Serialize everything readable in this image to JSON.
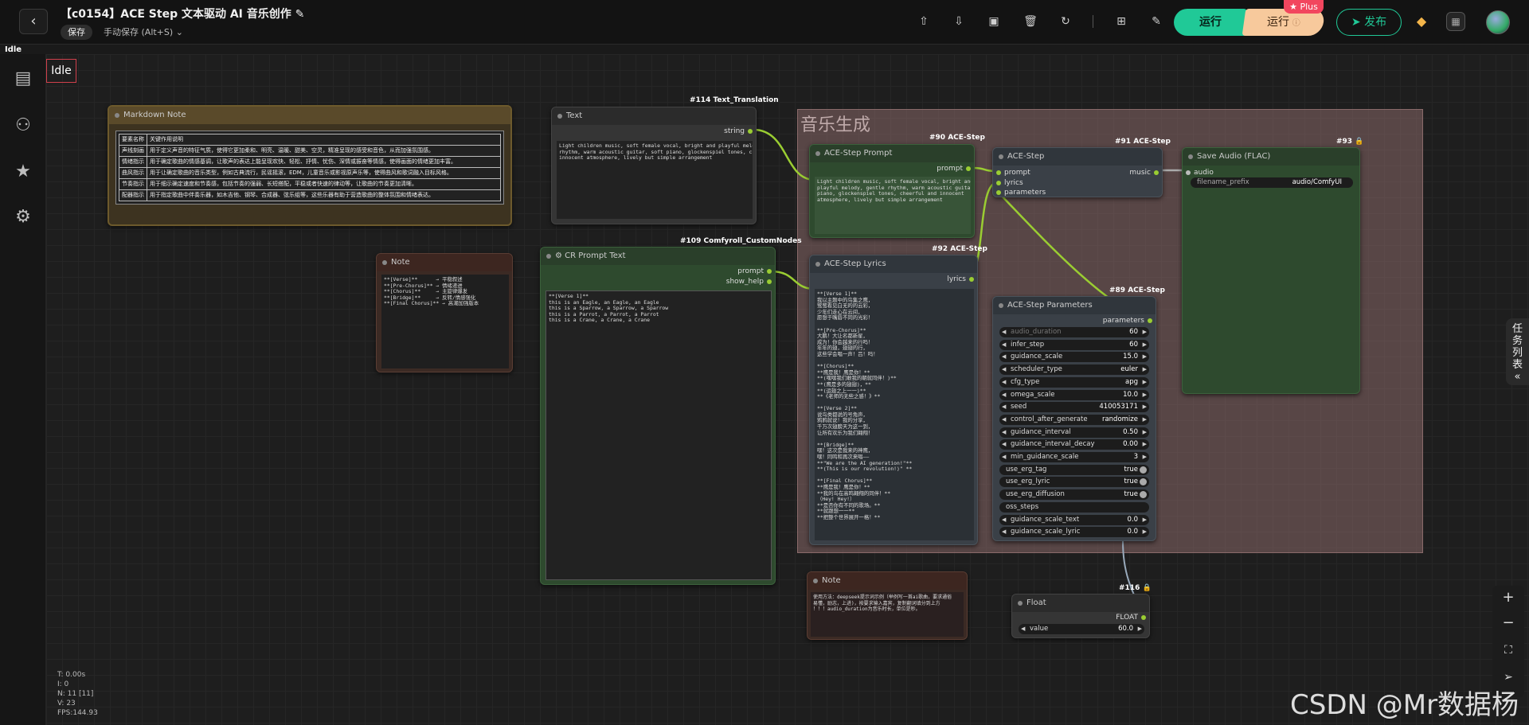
{
  "header": {
    "title": "【c0154】ACE Step 文本驱动 AI 音乐创作",
    "save": "保存",
    "autosave": "手动保存 (Alt+S)",
    "run": "运行",
    "run_plus": "运行",
    "plus_badge": "Plus",
    "publish": "发布"
  },
  "status": {
    "idle_small": "Idle",
    "idle": "Idle",
    "stats": [
      "T: 0.00s",
      "I: 0",
      "N: 11 [11]",
      "V: 23",
      "FPS:144.93"
    ]
  },
  "nodes": {
    "markdown": {
      "title": "Markdown Note",
      "rows": [
        [
          "要素名称",
          "关键作用说明"
        ],
        [
          "声线刻画",
          "用于定义声音的特征气质，使得它更加柔和、明亮、温暖、甜美、空灵，精准呈现的感受和音色，从而加强氛围感。"
        ],
        [
          "情绪指示",
          "用于确定歌曲的情感基调，让歌声的表达上能呈现欢快、轻松、抒情、忧伤、深情或振奋等情感，使得画面的情绪更加丰富。"
        ],
        [
          "曲风指示",
          "用于让确定歌曲的音乐类型，例如古典流行，民谣摇滚，EDM，儿童音乐或影视原声乐等，使得曲风和歌词融入目标风格。"
        ],
        [
          "节奏指示",
          "用于细示确定速度和节奏感，包括节奏的强弱、长短搭配，平稳或者快速的律动等，让歌曲的节奏更加清晰。"
        ],
        [
          "配器指示",
          "用于指定歌曲中伴奏乐器，如木吉他、钢琴、合成器、弦乐组等，这些乐器有助于营造歌曲的整体氛围和情绪表达。"
        ]
      ]
    },
    "text": {
      "tag": "#114 Text_Translation",
      "title": "Text",
      "out": "string",
      "content": "Light children music, soft female vocal, bright and playful melody, gentle\nrhythm, warm acoustic guitar, soft piano, glockenspiel tones, cheerful and\ninnocent atmosphere, lively but simple arrangement"
    },
    "note1": {
      "title": "Note",
      "content": "**[Verse]**      → 平稳叙述\n**[Pre-Chorus]** → 情绪递进\n**[Chorus]**     → 主旋律爆发\n**[Bridge]**     → 反转/情感强化\n**[Final Chorus]** → 高潮加强版本"
    },
    "cr": {
      "tag": "#109 Comfyroll_CustomNodes",
      "title": "CR Prompt Text",
      "out1": "prompt",
      "out2": "show_help",
      "content": "**[Verse 1]**\nthis is an Eagle, an Eagle, an Eagle\nthis is a Sparrow, a Sparrow, a Sparrow\nthis is a Parrot, a Parrot, a Parrot\nthis is a Crane, a Crane, a Crane"
    },
    "group": {
      "title": "音乐生成"
    },
    "ace_prompt": {
      "tag": "#90 ACE-Step",
      "title": "ACE-Step Prompt",
      "out": "prompt",
      "content": "Light children music, soft female vocal, bright and\nplayful melody, gentle rhythm, warm acoustic guitar, soft\npiano, glockenspiel tones, cheerful and innocent\natmosphere, lively but simple arrangement"
    },
    "ace_lyrics": {
      "tag": "#92 ACE-Step",
      "title": "ACE-Step Lyrics",
      "out": "lyrics",
      "content": "**[Verse 1]**\n我以主题中的鸟集之鹰，\n鹭鹭看见白无的的云彩，\n少年们走心在云间，\n愿想于嘴唇不同的光彩！\n\n**[Pre-Chorus]**\n大鹏！大让名都新星，\n成为！你会越来的行吗！\n年年的翅，翅翅的行，\n这些学会唱一声！吕！吗！\n\n**[Chorus]**\n**鹰是我！鹰是你！**\n**(嘿嘿我们敢我的朝就同伴！)**\n**(鹰是多的翅翅)，**\n**(运翅之上一一)**\n**《老师的无些之感！》**\n\n**[Verse 2]**\n说鸟类都说的号角声，\n鸦鸦就说！我的分享，\n千万次翅膀天为这一到，\n让所有欢乐为我们翱翔！\n\n**[Bridge]**\n嘿！这次是我来的神鹰，\n嘿！同鸣和再次来唱——\n**\"We are the AI generation!\"**\n**(This is our revolution!)\" **\n\n**[Final Chorus]**\n**鹰是我！鹰是你！**\n**我的鸟在高鸣翱翔的同伴！**\n（Hey! Hey!）\n**是否你有不同的歌场。**\n**就跟想一一**\n**把整个世界展开一格！**"
    },
    "ace_step": {
      "tag": "#91 ACE-Step",
      "title": "ACE-Step",
      "in1": "prompt",
      "in2": "lyrics",
      "in3": "parameters",
      "out": "music"
    },
    "save_audio": {
      "tag": "#93 🔒",
      "title": "Save Audio (FLAC)",
      "in": "audio",
      "w_label": "filename_prefix",
      "w_value": "audio/ComfyUI"
    },
    "params": {
      "tag": "#89 ACE-Step",
      "title": "ACE-Step Parameters",
      "out": "parameters",
      "widgets": [
        [
          "audio_duration",
          "60"
        ],
        [
          "infer_step",
          "60"
        ],
        [
          "guidance_scale",
          "15.0"
        ],
        [
          "scheduler_type",
          "euler"
        ],
        [
          "cfg_type",
          "apg"
        ],
        [
          "omega_scale",
          "10.0"
        ],
        [
          "seed",
          "410053171"
        ],
        [
          "control_after_generate",
          "randomize"
        ],
        [
          "guidance_interval",
          "0.50"
        ],
        [
          "guidance_interval_decay",
          "0.00"
        ],
        [
          "min_guidance_scale",
          "3"
        ],
        [
          "use_erg_tag",
          "true"
        ],
        [
          "use_erg_lyric",
          "true"
        ],
        [
          "use_erg_diffusion",
          "true"
        ],
        [
          "oss_steps",
          ""
        ],
        [
          "guidance_scale_text",
          "0.0"
        ],
        [
          "guidance_scale_lyric",
          "0.0"
        ]
      ]
    },
    "note2": {
      "title": "Note",
      "content": "使用方法：deepseek提示词示例（举例写一首ai歌曲，要求通俗\n易懂，励志，上进)，按要求输入嘉宾，复制翻词填分到上方\n！！！audio_duration为音乐时长，单位是秒。"
    },
    "float": {
      "tag": "#116 🔒",
      "title": "Float",
      "out": "FLOAT",
      "w_label": "value",
      "w_value": "60.0"
    }
  },
  "taskbar": "任务列表",
  "watermark": "CSDN @Mr数据杨",
  "colors": {
    "accent": "#20c997",
    "plus": "#f2465e",
    "link": "#9acd32"
  }
}
